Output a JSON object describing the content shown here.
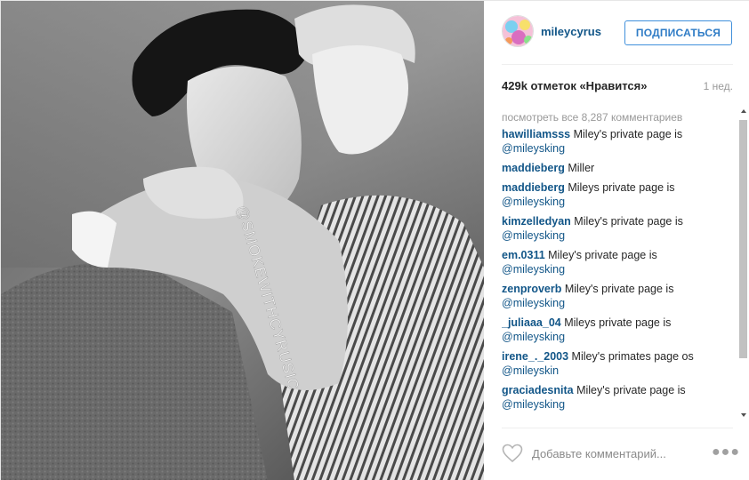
{
  "post": {
    "photo": {
      "watermark": "@SMOKEWITHCYRUSIC",
      "icon": "photo-icon"
    },
    "header": {
      "avatar_icon": "avatar-icon",
      "username": "mileycyrus",
      "follow_label": "ПОДПИСАТЬСЯ"
    },
    "stats": {
      "likes": "429k отметок «Нравится»",
      "time_ago": "1 нед."
    },
    "comments": {
      "view_all": "посмотреть все 8,287 комментариев",
      "items": [
        {
          "user": "hawilliamsss",
          "text": " Miley's private page is ",
          "mention": "@mileysking"
        },
        {
          "user": "maddieberg",
          "text": " Miller",
          "mention": ""
        },
        {
          "user": "maddieberg",
          "text": " Mileys private page is ",
          "mention": "@mileysking"
        },
        {
          "user": "kimzelledyan",
          "text": " Miley's private page is ",
          "mention": "@mileysking"
        },
        {
          "user": "em.0311",
          "text": " Miley's private page is ",
          "mention": "@mileysking"
        },
        {
          "user": "zenproverb",
          "text": " Miley's private page is ",
          "mention": "@mileysking"
        },
        {
          "user": "_juliaaa_04",
          "text": " Mileys private page is ",
          "mention": "@mileysking"
        },
        {
          "user": "irene_._2003",
          "text": " Miley's primates page os ",
          "mention": "@mileyskin"
        },
        {
          "user": "graciadesnita",
          "text": " Miley's private page is ",
          "mention": "@mileysking"
        }
      ]
    },
    "add_comment": {
      "placeholder": "Добавьте комментарий...",
      "like_icon": "heart-icon",
      "more_icon": "more-options-icon"
    }
  },
  "colors": {
    "username_blue": "#125688",
    "follow_border": "#4090db",
    "muted_text": "#999999",
    "divider": "#efefef"
  }
}
